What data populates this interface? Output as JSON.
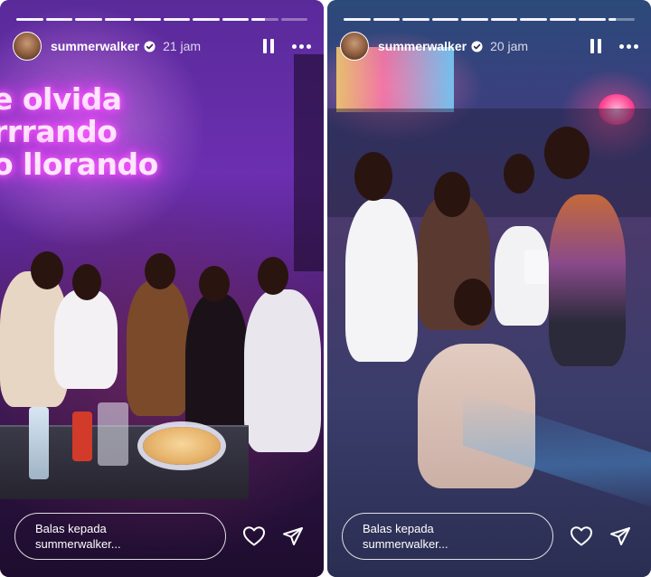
{
  "stories": [
    {
      "username": "summerwalker",
      "time": "21 jam",
      "progress_segments_done": 8,
      "progress_segments_total": 10,
      "current_segment_progress": 0.5,
      "neon_sign": [
        "e olvida",
        "rrrando",
        "o llorando"
      ],
      "reply_placeholder_line1": "Balas kepada",
      "reply_placeholder_line2": "summerwalker..."
    },
    {
      "username": "summerwalker",
      "time": "20 jam",
      "progress_segments_done": 9,
      "progress_segments_total": 10,
      "current_segment_progress": 0.3,
      "reply_placeholder_line1": "Balas kepada",
      "reply_placeholder_line2": "summerwalker..."
    }
  ],
  "icons": {
    "verified": "verified-badge-icon",
    "pause": "pause-icon",
    "more": "more-options-icon",
    "like": "heart-icon",
    "share": "send-icon"
  },
  "colors": {
    "left_tint": "#6b2fb0",
    "right_tint": "#3b3f7e",
    "neon": "#ff66ff",
    "ui_text": "#ffffff"
  }
}
